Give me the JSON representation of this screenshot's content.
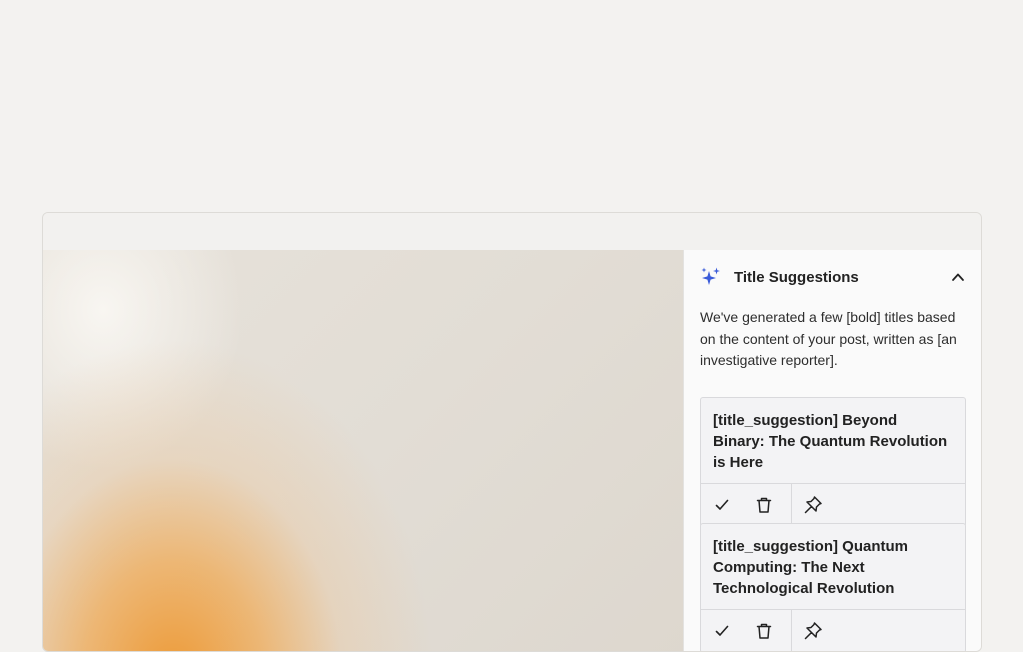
{
  "panel": {
    "title": "Title Suggestions",
    "description": "We've generated a few [bold] titles based on the content of your post, written as [an investigative reporter].",
    "header_icon": "sparkle-icon",
    "collapse_icon": "chevron-up-icon",
    "accent_color": "#3a5bd9"
  },
  "suggestions": [
    {
      "text": "[title_suggestion] Beyond Binary: The Quantum Revolution is Here",
      "actions": [
        "check-icon",
        "trash-icon",
        "pin-icon"
      ]
    },
    {
      "text": "[title_suggestion] Quantum Computing: The Next Technological Revolution",
      "actions": [
        "check-icon",
        "trash-icon",
        "pin-icon"
      ]
    }
  ]
}
